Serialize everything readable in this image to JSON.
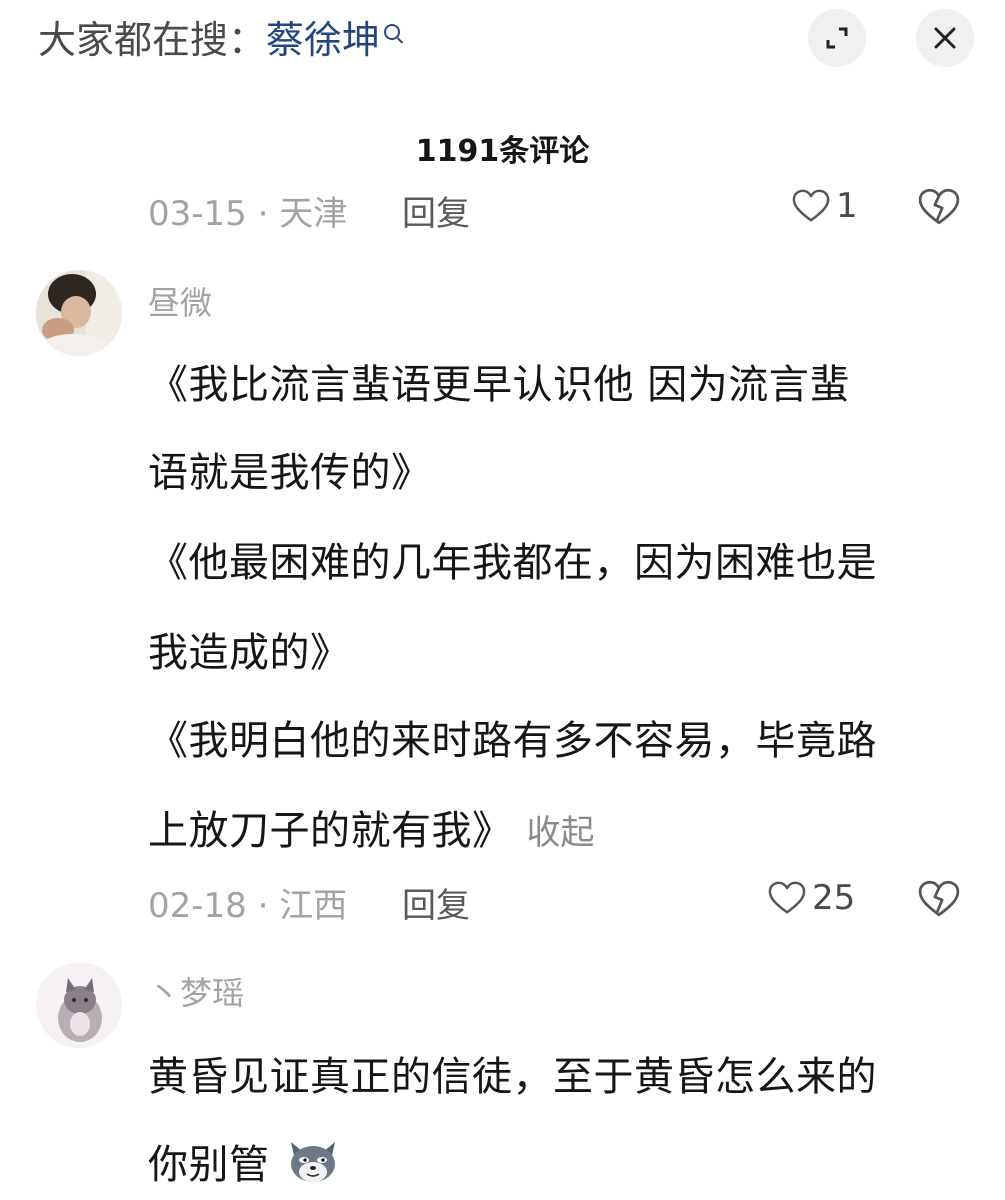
{
  "header": {
    "search_prefix": "大家都在搜：",
    "search_keyword": "蔡徐坤"
  },
  "comment_count": "1191条评论",
  "prev_comment_footer": {
    "date_location": "03-15 · 天津",
    "reply_label": "回复",
    "like_count": "1"
  },
  "comments": [
    {
      "username": "昼微",
      "lines": [
        "《我比流言蜚语更早认识他  因为流言蜚",
        "语就是我传的》",
        "《他最困难的几年我都在，因为困难也是",
        "我造成的》",
        "《我明白他的来时路有多不容易，毕竟路",
        "上放刀子的就有我》"
      ],
      "collapse_label": "收起",
      "date_location": "02-18 · 江西",
      "reply_label": "回复",
      "like_count": "25"
    },
    {
      "username": "丶梦瑶",
      "lines": [
        "黄昏见证真正的信徒，至于黄昏怎么来的",
        "你别管"
      ]
    }
  ],
  "icons": {
    "expand": "expand-icon",
    "close": "close-icon",
    "heart": "heart-outline-icon",
    "dislike": "broken-heart-icon",
    "sticker": "wolf-sticker-emoji"
  },
  "colors": {
    "keyword": "#24467f",
    "meta": "#a3a3a3",
    "text": "#161616"
  }
}
